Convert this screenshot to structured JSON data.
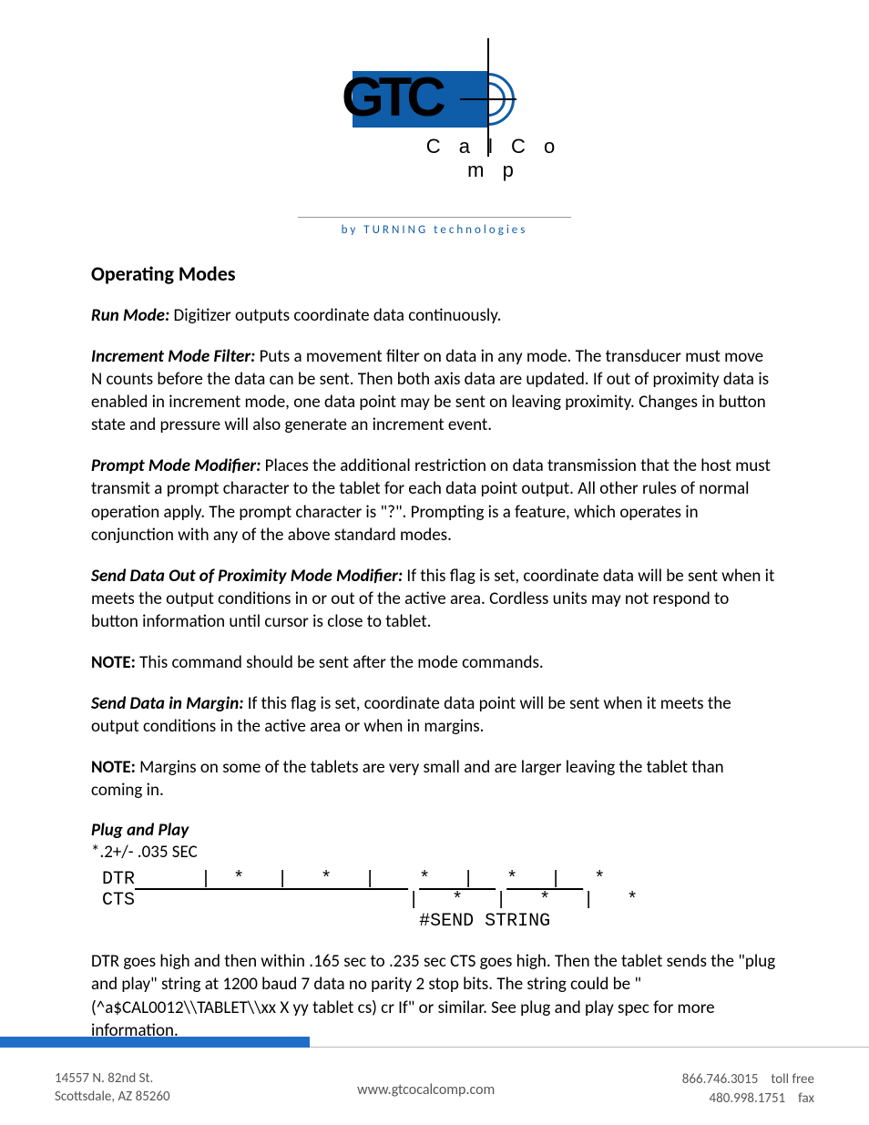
{
  "logo": {
    "main": "GTC",
    "sub": "C a l C o m p",
    "tagline": "by  TURNING  technologies"
  },
  "heading": "Operating Modes",
  "modes": {
    "run": {
      "label": "Run Mode:",
      "text": " Digitizer outputs coordinate data continuously."
    },
    "increment": {
      "label": "Increment Mode Filter:",
      "text": " Puts a movement filter on data in any mode.  The transducer must move N counts before the data can be sent.  Then both axis data are updated.  If out of proximity data is enabled in increment mode, one data point may be sent on leaving proximity.  Changes in button state and pressure will also generate an increment event."
    },
    "prompt": {
      "label": "Prompt Mode Modifier:",
      "text": " Places the additional restriction on data transmission that the host must transmit a prompt character to the tablet for each data point output.  All other rules of normal operation apply.  The prompt character is \"?\".  Prompting is a feature, which operates in conjunction with any of the above standard modes."
    },
    "proximity": {
      "label": "Send Data Out of Proximity Mode Modifier:",
      "text": " If this flag is set, coordinate data will be sent when it meets the output conditions in or out of the active area.  Cordless units may not respond to button information until cursor is close to tablet."
    },
    "note1": {
      "label": "NOTE:",
      "text": " This command should be sent after the mode commands."
    },
    "margin": {
      "label": "Send Data in Margin:",
      "text": " If this flag is set, coordinate data point will be sent when it meets the output conditions in the active area or when in margins."
    },
    "note2": {
      "label": "NOTE:",
      "text": " Margins on some of the tablets are very small and are larger leaving the tablet than coming in."
    }
  },
  "plug": {
    "title": "Plug and Play",
    "timing": "*.2+/- .035 SEC",
    "dtr_label": "DTR",
    "cts_label": "CTS",
    "send_label": "#SEND STRING",
    "explain": "DTR goes high and then within .165 sec to .235 sec CTS goes high.  Then the tablet sends the \"plug and play\" string at 1200 baud 7 data no parity 2 stop bits.  The string could be \"(^a$CAL0012\\\\TABLET\\\\xx X yy tablet cs) cr If\" or similar.  See plug and play spec for more information."
  },
  "footer": {
    "address1": "14557 N. 82nd St.",
    "address2": "Scottsdale, AZ 85260",
    "website": "www.gtcocalcomp.com",
    "tollfree_num": "866.746.3015",
    "tollfree_lbl": "toll free",
    "fax_num": "480.998.1751",
    "fax_lbl": "fax"
  }
}
